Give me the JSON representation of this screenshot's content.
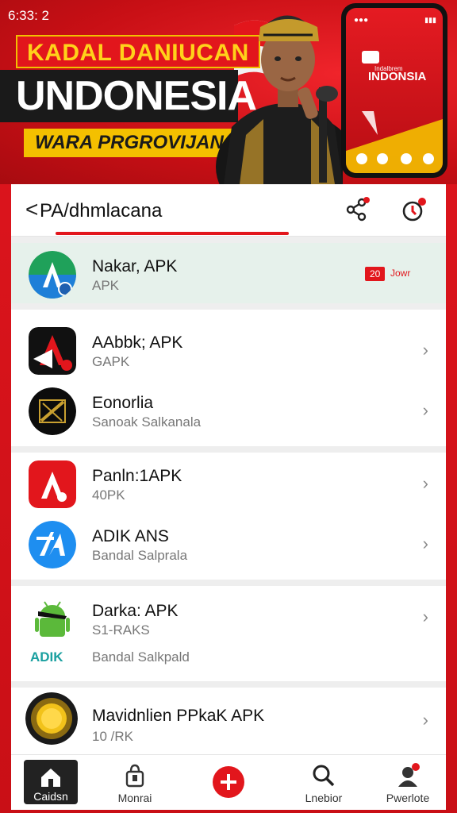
{
  "banner": {
    "status_time": "6:33: 2",
    "headline_small": "KADAL DANIUCAN",
    "headline_big": "UNDONESIA",
    "headline_strip": "WARA PRGROVIJAN",
    "phone": {
      "title": "INDONSIA",
      "subtitle": "Indalbrem"
    }
  },
  "topbar": {
    "back_glyph": "<",
    "title": "PA/dhmlacana"
  },
  "groups": [
    {
      "rows": [
        {
          "title": "Nakar, APK",
          "subtitle": "APK",
          "highlight": true,
          "badge": "20",
          "badge_text": "Jowr",
          "icon": "app-icon-green-a"
        }
      ]
    },
    {
      "rows": [
        {
          "title": "AAbbk; APK",
          "subtitle": "GAPK",
          "icon": "app-icon-dark-a"
        },
        {
          "title": "Eonorlia",
          "subtitle": "Sanoak Salkanala",
          "icon": "app-icon-black-circle"
        }
      ]
    },
    {
      "rows": [
        {
          "title": "Panln:1APK",
          "subtitle": "40PK",
          "icon": "app-icon-red-a"
        },
        {
          "title": "ADIK ANS",
          "subtitle": "Bandal Salpralа",
          "icon": "app-icon-blue-a"
        }
      ]
    },
    {
      "rows": [
        {
          "title": "Darka: APK",
          "subtitle": "S1-RAKS",
          "subtitle2": "Bandal Salkpald",
          "logo_text": "ADIK",
          "icon": "android-icon"
        }
      ]
    },
    {
      "rows": [
        {
          "title": "Mavidnlien PPkaK APK",
          "subtitle": "10 /RK",
          "icon": "app-icon-gold-coin"
        }
      ]
    }
  ],
  "bottomnav": [
    {
      "label": "Caidsn",
      "icon": "home-icon"
    },
    {
      "label": "Monrai",
      "icon": "bag-icon"
    },
    {
      "label": "",
      "icon": "add-icon"
    },
    {
      "label": "Lnebior",
      "icon": "search-icon"
    },
    {
      "label": "Pwerlote",
      "icon": "profile-icon"
    }
  ],
  "colors": {
    "brand_red": "#e2161c",
    "highlight_row": "#e6f1eb"
  }
}
